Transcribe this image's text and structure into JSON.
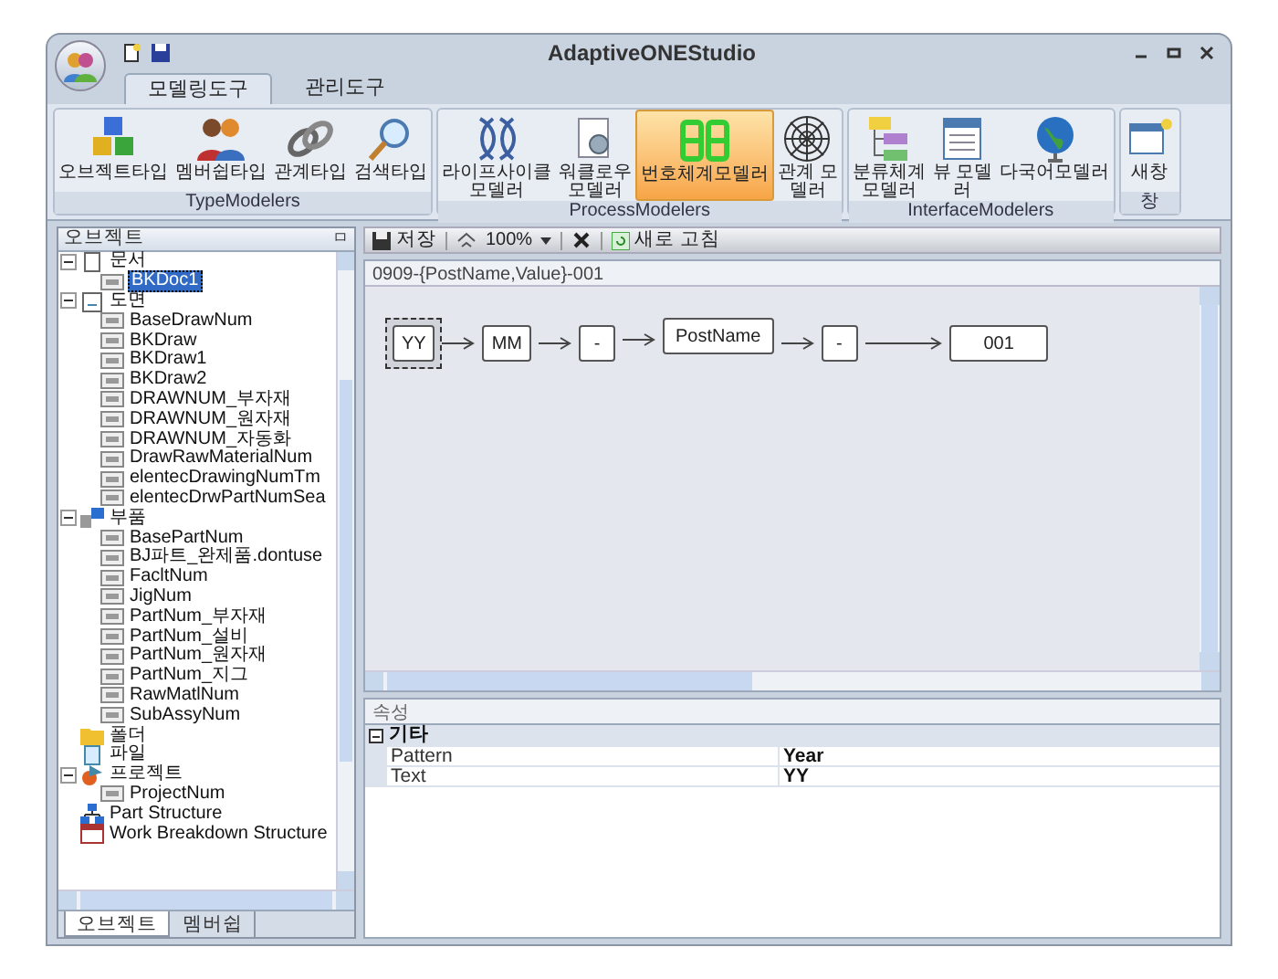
{
  "window": {
    "title": "AdaptiveONEStudio"
  },
  "ribbon_tabs": [
    {
      "label": "모델링도구",
      "selected": true
    },
    {
      "label": "관리도구",
      "selected": false
    }
  ],
  "ribbon_groups": [
    {
      "label": "TypeModelers",
      "buttons": [
        {
          "label": "오브젝트타입",
          "kind": "cubes",
          "selected": false
        },
        {
          "label": "멤버쉽타입",
          "kind": "people",
          "selected": false
        },
        {
          "label": "관계타입",
          "kind": "link",
          "selected": false
        },
        {
          "label": "검색타입",
          "kind": "search",
          "selected": false
        }
      ]
    },
    {
      "label": "ProcessModelers",
      "buttons": [
        {
          "label": "라이프사이클\n모델러",
          "kind": "lifecycle",
          "selected": false
        },
        {
          "label": "워클로우\n모델러",
          "kind": "workflow",
          "selected": false
        },
        {
          "label": "번호체계모델러",
          "kind": "digits",
          "selected": true
        },
        {
          "label": "관계 모\n델러",
          "kind": "web",
          "selected": false
        }
      ]
    },
    {
      "label": "InterfaceModelers",
      "buttons": [
        {
          "label": "분류체계\n모델러",
          "kind": "tree",
          "selected": false
        },
        {
          "label": "뷰 모델\n러",
          "kind": "view",
          "selected": false
        },
        {
          "label": "다국어모델러",
          "kind": "globe",
          "selected": false
        }
      ]
    },
    {
      "label": "창",
      "buttons": [
        {
          "label": "새창",
          "kind": "window",
          "selected": false
        }
      ]
    }
  ],
  "object_panel": {
    "title": "오브젝트",
    "pin": "ㅁ",
    "tree": [
      {
        "label": "문서",
        "kind": "doc",
        "expanded": true,
        "children": [
          {
            "label": "BKDoc1",
            "kind": "item",
            "selected": true
          }
        ]
      },
      {
        "label": "도면",
        "kind": "drawing",
        "expanded": true,
        "children": [
          {
            "label": "BaseDrawNum",
            "kind": "item",
            "selected": false
          },
          {
            "label": "BKDraw",
            "kind": "item",
            "selected": false
          },
          {
            "label": "BKDraw1",
            "kind": "item",
            "selected": false
          },
          {
            "label": "BKDraw2",
            "kind": "item",
            "selected": false
          },
          {
            "label": "DRAWNUM_부자재",
            "kind": "item",
            "selected": false
          },
          {
            "label": "DRAWNUM_원자재",
            "kind": "item",
            "selected": false
          },
          {
            "label": "DRAWNUM_자동화",
            "kind": "item",
            "selected": false
          },
          {
            "label": "DrawRawMaterialNum",
            "kind": "item",
            "selected": false
          },
          {
            "label": "elentecDrawingNumTm",
            "kind": "item",
            "selected": false
          },
          {
            "label": "elentecDrwPartNumSea",
            "kind": "item",
            "selected": false
          }
        ]
      },
      {
        "label": "부품",
        "kind": "part",
        "expanded": true,
        "children": [
          {
            "label": "BasePartNum",
            "kind": "item",
            "selected": false
          },
          {
            "label": "BJ파트_완제품.dontuse",
            "kind": "item",
            "selected": false
          },
          {
            "label": "FacltNum",
            "kind": "item",
            "selected": false
          },
          {
            "label": "JigNum",
            "kind": "item",
            "selected": false
          },
          {
            "label": "PartNum_부자재",
            "kind": "item",
            "selected": false
          },
          {
            "label": "PartNum_설비",
            "kind": "item",
            "selected": false
          },
          {
            "label": "PartNum_원자재",
            "kind": "item",
            "selected": false
          },
          {
            "label": "PartNum_지그",
            "kind": "item",
            "selected": false
          },
          {
            "label": "RawMatlNum",
            "kind": "item",
            "selected": false
          },
          {
            "label": "SubAssyNum",
            "kind": "item",
            "selected": false
          }
        ]
      },
      {
        "label": "폴더",
        "kind": "folder"
      },
      {
        "label": "파일",
        "kind": "file"
      },
      {
        "label": "프로젝트",
        "kind": "project",
        "expanded": true,
        "children": [
          {
            "label": "ProjectNum",
            "kind": "item",
            "selected": false
          }
        ]
      },
      {
        "label": "Part Structure",
        "kind": "structure"
      },
      {
        "label": "Work Breakdown Structure",
        "kind": "wbs"
      }
    ],
    "tabs": [
      {
        "label": "오브젝트",
        "selected": true
      },
      {
        "label": "멤버쉽",
        "selected": false
      }
    ]
  },
  "toolbar": {
    "save": "저장",
    "zoom": "100%",
    "refresh": "새로 고침"
  },
  "formula": "0909-{PostName,Value}-001",
  "diagram_nodes": [
    {
      "label": "YY",
      "selected": true
    },
    {
      "label": "MM",
      "selected": false
    },
    {
      "label": "-",
      "selected": false
    },
    {
      "label": "PostName",
      "selected": false
    },
    {
      "label": "-",
      "selected": false
    },
    {
      "label": "001",
      "selected": false
    }
  ],
  "properties": {
    "title": "속성",
    "categories": [
      {
        "label": "기타",
        "expanded": true,
        "rows": [
          {
            "name": "Pattern",
            "value": "Year"
          },
          {
            "name": "Text",
            "value": "YY"
          }
        ]
      }
    ]
  }
}
